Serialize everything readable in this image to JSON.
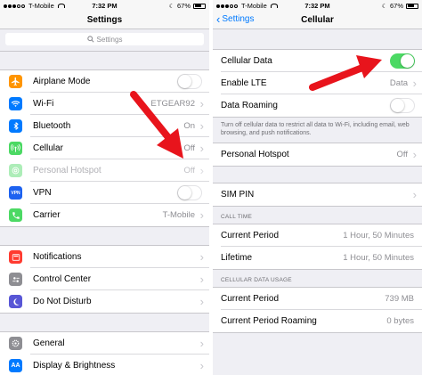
{
  "colors": {
    "accent": "#007aff",
    "toggle_on": "#4cd964",
    "arrow": "#e8141c"
  },
  "left": {
    "status": {
      "carrier": "T-Mobile",
      "time": "7:32 PM",
      "battery": "67%"
    },
    "nav_title": "Settings",
    "search_placeholder": "Settings",
    "group1": [
      {
        "label": "Airplane Mode",
        "icon": "airplane-icon",
        "color": "#ff9500",
        "toggle": false
      },
      {
        "label": "Wi-Fi",
        "icon": "wifi-icon",
        "color": "#007aff",
        "value": "ETGEAR92"
      },
      {
        "label": "Bluetooth",
        "icon": "bluetooth-icon",
        "color": "#007aff",
        "value": "On"
      },
      {
        "label": "Cellular",
        "icon": "cellular-icon",
        "color": "#4cd964",
        "value": "Off"
      },
      {
        "label": "Personal Hotspot",
        "icon": "hotspot-icon",
        "color": "#4cd964",
        "value": "Off"
      },
      {
        "label": "VPN",
        "icon": "vpn-icon",
        "icon_text": "VPN",
        "color": "#1d62f0",
        "toggle": false
      },
      {
        "label": "Carrier",
        "icon": "phone-icon",
        "color": "#4cd964",
        "value": "T-Mobile"
      }
    ],
    "group2": [
      {
        "label": "Notifications",
        "icon": "notifications-icon",
        "color": "#ff3b30"
      },
      {
        "label": "Control Center",
        "icon": "control-center-icon",
        "color": "#8e8e93"
      },
      {
        "label": "Do Not Disturb",
        "icon": "moon-icon",
        "color": "#5856d6"
      }
    ],
    "group3": [
      {
        "label": "General",
        "icon": "gear-icon",
        "color": "#8e8e93"
      },
      {
        "label": "Display & Brightness",
        "icon": "display-icon",
        "icon_text": "AA",
        "color": "#007aff"
      }
    ]
  },
  "right": {
    "status": {
      "carrier": "T-Mobile",
      "time": "7:32 PM",
      "battery": "67%"
    },
    "nav_back": "Settings",
    "nav_title": "Cellular",
    "cellular_data": {
      "label": "Cellular Data",
      "toggle": true
    },
    "enable_lte": {
      "label": "Enable LTE",
      "value": "Data"
    },
    "data_roaming": {
      "label": "Data Roaming",
      "toggle": false
    },
    "footnote": "Turn off cellular data to restrict all data to Wi-Fi, including email, web browsing, and push notifications.",
    "personal_hotspot": {
      "label": "Personal Hotspot",
      "value": "Off"
    },
    "sim_pin": {
      "label": "SIM PIN"
    },
    "call_time_header": "CALL TIME",
    "current_period": {
      "label": "Current Period",
      "value": "1 Hour, 50 Minutes"
    },
    "lifetime": {
      "label": "Lifetime",
      "value": "1 Hour, 50 Minutes"
    },
    "usage_header": "CELLULAR DATA USAGE",
    "usage_current": {
      "label": "Current Period",
      "value": "739 MB"
    },
    "usage_roaming": {
      "label": "Current Period Roaming",
      "value": "0 bytes"
    }
  }
}
